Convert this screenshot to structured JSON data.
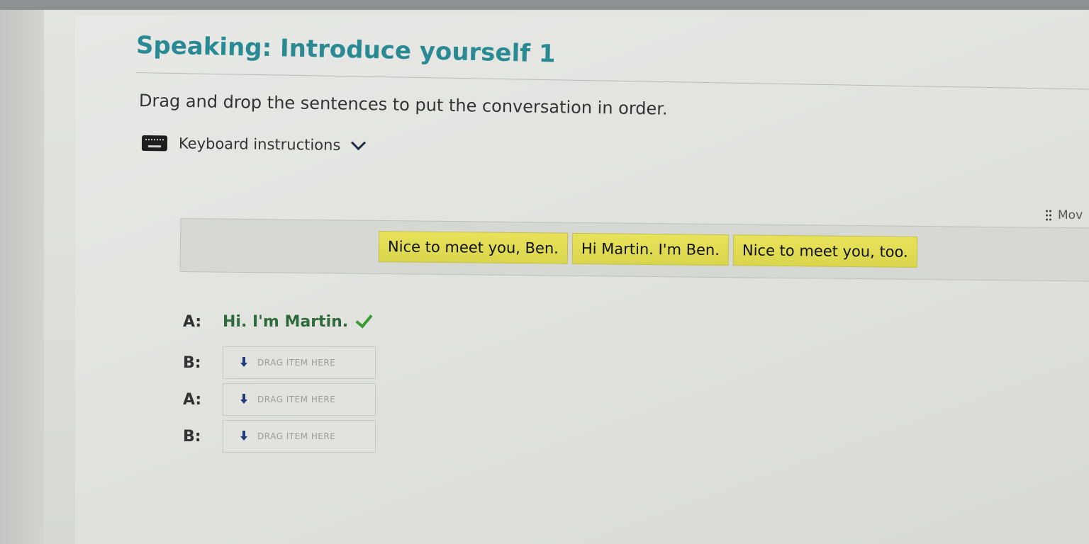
{
  "page": {
    "title": "Speaking: Introduce yourself 1",
    "instructions": "Drag and drop the sentences to put the conversation in order.",
    "keyboard_toggle_label": "Keyboard instructions",
    "move_label": "Mov"
  },
  "tiles": [
    "Nice to meet you, Ben.",
    "Hi Martin. I'm Ben.",
    "Nice to meet you, too."
  ],
  "dialog": [
    {
      "speaker": "A:",
      "text": "Hi. I'm Martin.",
      "status": "correct"
    },
    {
      "speaker": "B:",
      "placeholder": "DRAG ITEM HERE"
    },
    {
      "speaker": "A:",
      "placeholder": "DRAG ITEM HERE"
    },
    {
      "speaker": "B:",
      "placeholder": "DRAG ITEM HERE"
    }
  ],
  "colors": {
    "title": "#2a8a94",
    "tile_bg": "#e2dd55",
    "answered_text": "#2f6b3c",
    "check": "#3a9a35"
  },
  "icons": [
    "keyboard-icon",
    "chevron-down-icon",
    "grip-icon",
    "check-icon",
    "arrow-down-icon"
  ]
}
